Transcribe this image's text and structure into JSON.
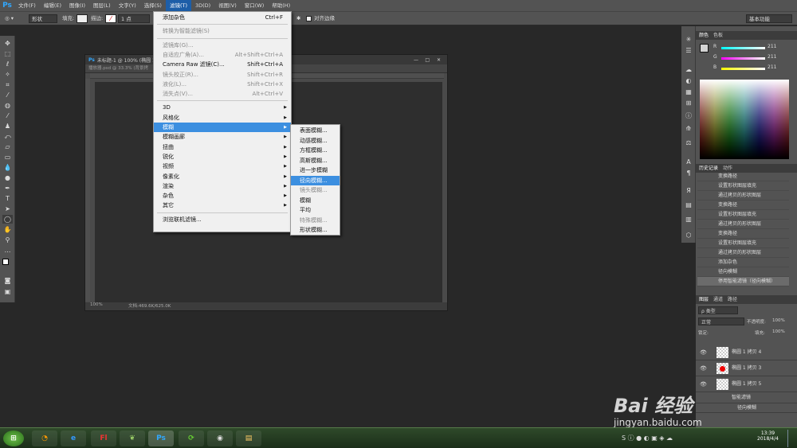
{
  "menubar": {
    "logo": "Ps",
    "items": [
      "文件(F)",
      "编辑(E)",
      "图像(I)",
      "图层(L)",
      "文字(Y)",
      "选择(S)",
      "滤镜(T)",
      "3D(D)",
      "视图(V)",
      "窗口(W)",
      "帮助(H)"
    ],
    "active_index": 6
  },
  "options": {
    "shape": "形状",
    "fill_label": "填充:",
    "stroke_label": "描边:",
    "stroke_size": "1 点",
    "align_edges": "对齐边缘",
    "workspace": "基本功能"
  },
  "document": {
    "title": "未标题-1 @ 100% (椭圆 1",
    "tab2": "播放器.psd @ 33.3% (背景拷",
    "zoom": "100%",
    "doc_info": "文档:469.6K/625.0K"
  },
  "filter_menu": {
    "items": [
      {
        "label": "添加杂色",
        "shortcut": "Ctrl+F",
        "state": "normal"
      },
      {
        "sep": true
      },
      {
        "label": "转换为智能滤镜(S)",
        "shortcut": "",
        "state": "disabled"
      },
      {
        "sep": true
      },
      {
        "label": "滤镜库(G)...",
        "shortcut": "",
        "state": "disabled"
      },
      {
        "label": "自适应广角(A)...",
        "shortcut": "Alt+Shift+Ctrl+A",
        "state": "disabled"
      },
      {
        "label": "Camera Raw 滤镜(C)...",
        "shortcut": "Shift+Ctrl+A",
        "state": "normal"
      },
      {
        "label": "镜头校正(R)...",
        "shortcut": "Shift+Ctrl+R",
        "state": "disabled"
      },
      {
        "label": "液化(L)...",
        "shortcut": "Shift+Ctrl+X",
        "state": "disabled"
      },
      {
        "label": "消失点(V)...",
        "shortcut": "Alt+Ctrl+V",
        "state": "disabled"
      },
      {
        "sep": true
      },
      {
        "label": "3D",
        "submenu": true,
        "state": "normal"
      },
      {
        "label": "风格化",
        "submenu": true,
        "state": "normal"
      },
      {
        "label": "模糊",
        "submenu": true,
        "state": "highlighted"
      },
      {
        "label": "模糊画廊",
        "submenu": true,
        "state": "normal"
      },
      {
        "label": "扭曲",
        "submenu": true,
        "state": "normal"
      },
      {
        "label": "锐化",
        "submenu": true,
        "state": "normal"
      },
      {
        "label": "视频",
        "submenu": true,
        "state": "normal"
      },
      {
        "label": "像素化",
        "submenu": true,
        "state": "normal"
      },
      {
        "label": "渲染",
        "submenu": true,
        "state": "normal"
      },
      {
        "label": "杂色",
        "submenu": true,
        "state": "normal"
      },
      {
        "label": "其它",
        "submenu": true,
        "state": "normal"
      },
      {
        "sep": true
      },
      {
        "label": "浏览联机滤镜...",
        "shortcut": "",
        "state": "normal"
      }
    ]
  },
  "blur_submenu": {
    "items": [
      {
        "label": "表面模糊...",
        "state": "normal"
      },
      {
        "label": "动感模糊...",
        "state": "normal"
      },
      {
        "label": "方框模糊...",
        "state": "normal"
      },
      {
        "label": "高斯模糊...",
        "state": "normal"
      },
      {
        "label": "进一步模糊",
        "state": "normal"
      },
      {
        "label": "径向模糊...",
        "state": "highlighted"
      },
      {
        "label": "镜头模糊...",
        "state": "disabled"
      },
      {
        "label": "模糊",
        "state": "normal"
      },
      {
        "label": "平均",
        "state": "normal"
      },
      {
        "label": "特殊模糊...",
        "state": "disabled"
      },
      {
        "label": "形状模糊...",
        "state": "normal"
      }
    ]
  },
  "color_panel": {
    "tabs": [
      "颜色",
      "色板"
    ],
    "r_label": "R",
    "g_label": "G",
    "b_label": "B",
    "r": "211",
    "g": "211",
    "b": "211"
  },
  "history_panel": {
    "tabs": [
      "历史记录",
      "动作"
    ],
    "items": [
      "变换路径",
      "设置形状图层填充",
      "通过拷贝的形状图层",
      "变换路径",
      "设置形状图层填充",
      "通过拷贝的形状图层",
      "变换路径",
      "设置形状图层填充",
      "通过拷贝的形状图层",
      "添加杂色",
      "径向模糊",
      "停用智能滤镜（径向模糊）"
    ]
  },
  "layers_panel": {
    "tabs": [
      "图层",
      "通道",
      "路径"
    ],
    "kind": "ρ 类型",
    "blend": "正常",
    "opacity_label": "不透明度:",
    "opacity": "100%",
    "lock_label": "锁定:",
    "fill_label": "填充:",
    "fill": "100%",
    "layers": [
      "椭圆 1 拷贝 4",
      "椭圆 1 拷贝 3",
      "椭圆 1 拷贝 5",
      "智能滤镜",
      "径向模糊"
    ]
  },
  "taskbar": {
    "time": "13:39",
    "date": "2018/4/4"
  },
  "watermark": {
    "text": "Bai 经验",
    "url": "jingyan.baidu.com"
  },
  "colors": {
    "accent": "#3c8fe0",
    "ps_blue": "#31a8ff"
  }
}
